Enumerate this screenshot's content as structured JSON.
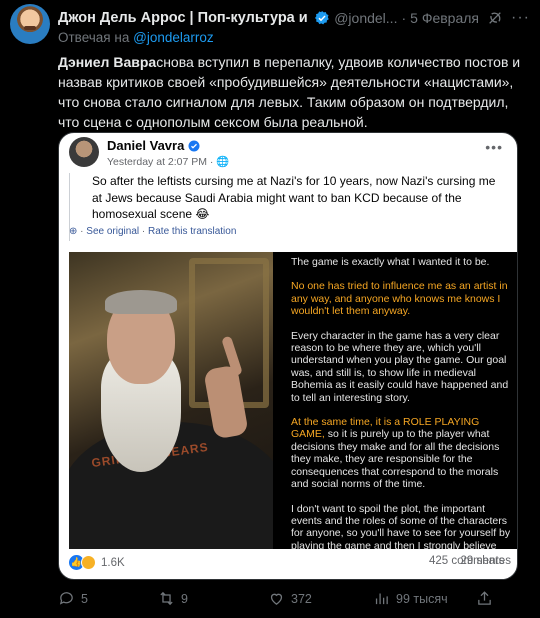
{
  "tweet": {
    "author_name": "Джон Дель Аррос | Поп-культура и ...",
    "handle": "@jondel...",
    "separator": "·",
    "date": "5 Февраля",
    "reply_prefix": "Отвечая на",
    "reply_to": "@jondelarroz",
    "text_bold": "Дэниел Вавра",
    "text_rest": "снова вступил в перепалку, удвоив количество постов и назвав критиков своей «пробудившейся» деятельности «нацистами», что снова стало сигналом для левых. Таким образом он подтвердил, что сцена с однополым сексом была реальной."
  },
  "embedded_post": {
    "author": "Daniel Vavra",
    "timestamp": "Yesterday at 2:07 PM ·",
    "body": "So after the leftists cursing me at Nazi's for 10 years, now Nazi's cursing me at Jews because Saudi Arabia might want to ban KCD because of the homosexual scene 😂",
    "see_original": "See original",
    "rate_translation": "Rate this translation",
    "image_paragraphs": [
      {
        "text": "The game is exactly what I wanted it to be.",
        "highlight": false
      },
      {
        "text": "No one has tried to influence me as an artist in any way, and anyone who knows me knows I wouldn't let them anyway.",
        "highlight": true
      },
      {
        "text": "Every character in the game has a very clear reason to be where they are, which you'll understand when you play the game. Our goal was, and still is, to show life in medieval Bohemia as it easily could have happened and to tell an interesting story.",
        "highlight": false
      },
      {
        "text": "At the same time, it is a ROLE PLAYING GAME, so it is purely up to the player what decisions they make and for all the decisions they make, they are responsible for the consequences that correspond to the morals and social norms of the time.",
        "highlight": false
      },
      {
        "text": "I don't want to spoil the plot, the important events and the roles of some of the characters for anyone, so you'll have to see for yourself by playing the game and then I strongly believe you'll agree with me.",
        "highlight": false
      }
    ],
    "shirt_text": "GRIPPING BEARS",
    "reactions_count": "1.6K",
    "comments": "425 comments",
    "shares": "29 shares"
  },
  "actions": {
    "replies": "5",
    "retweets": "9",
    "likes": "372",
    "views": "99 тысяч"
  },
  "colors": {
    "accent": "#1d9bf0",
    "muted": "#71767b",
    "highlight": "#f5a623"
  }
}
